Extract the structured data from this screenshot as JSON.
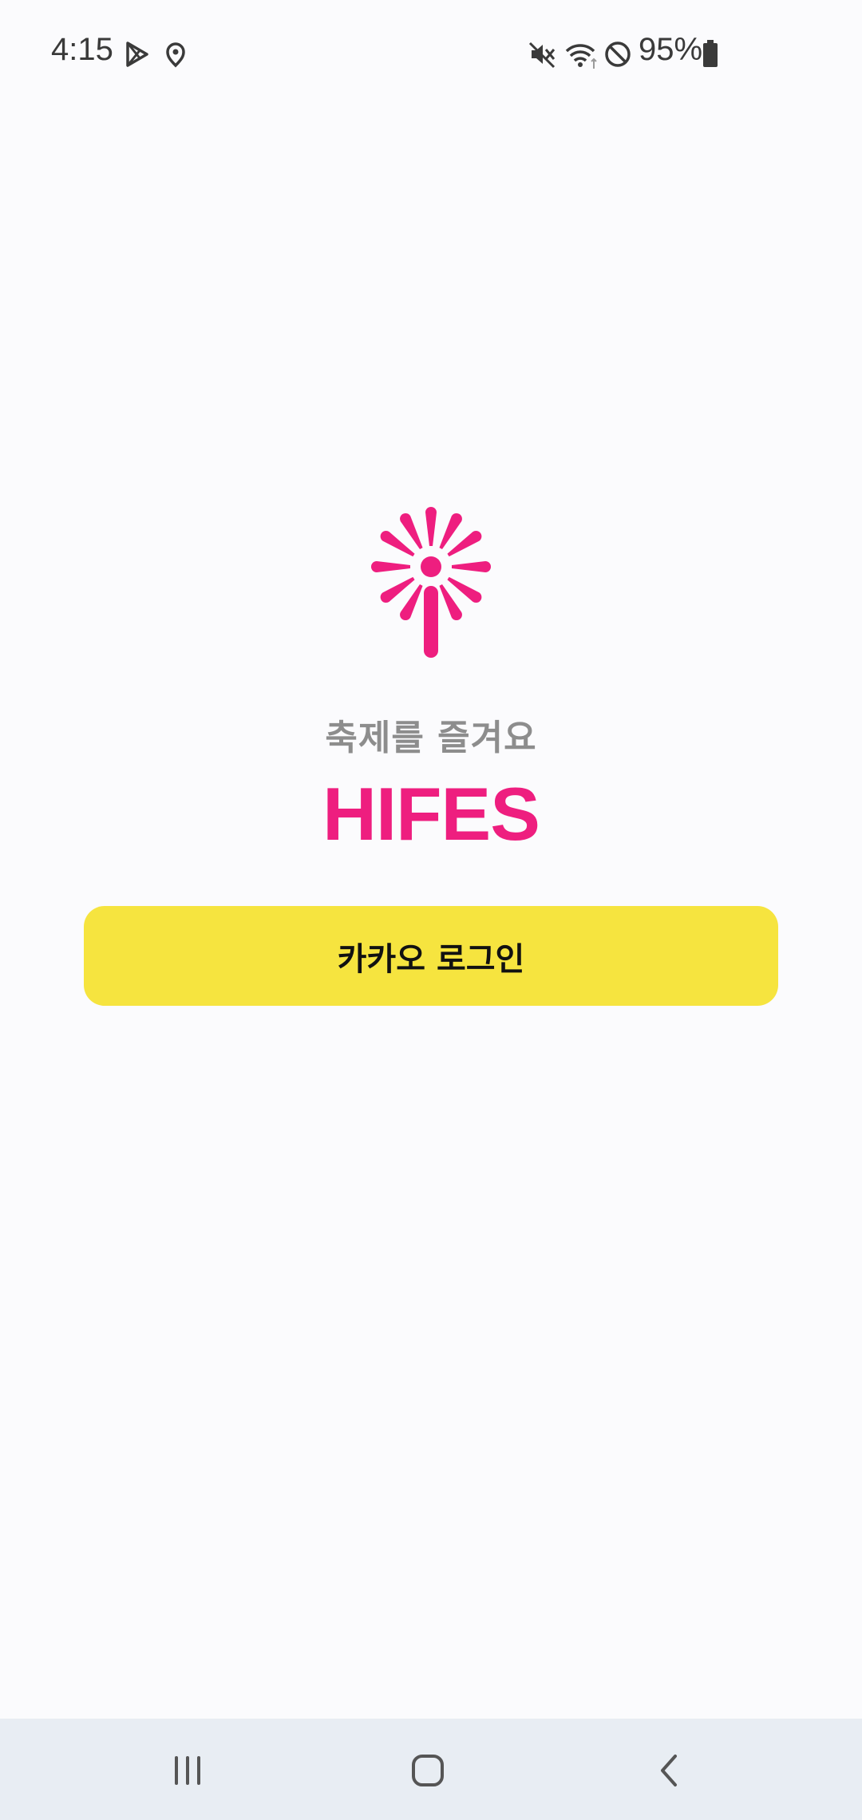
{
  "status_bar": {
    "time": "4:15",
    "battery_percent": "95%",
    "icons": [
      "play-store-icon",
      "location-icon",
      "mute-icon",
      "wifi-icon",
      "do-not-disturb-icon",
      "battery-icon"
    ]
  },
  "splash": {
    "tagline": "축제를 즐겨요",
    "brand": "HIFES",
    "logo_icon": "firework-icon",
    "brand_color": "#ee1e7f"
  },
  "login": {
    "kakao_label": "카카오 로그인",
    "button_color": "#f6e43f"
  },
  "nav_bar": {
    "icons": [
      "recent-apps-icon",
      "home-icon",
      "back-icon"
    ]
  }
}
